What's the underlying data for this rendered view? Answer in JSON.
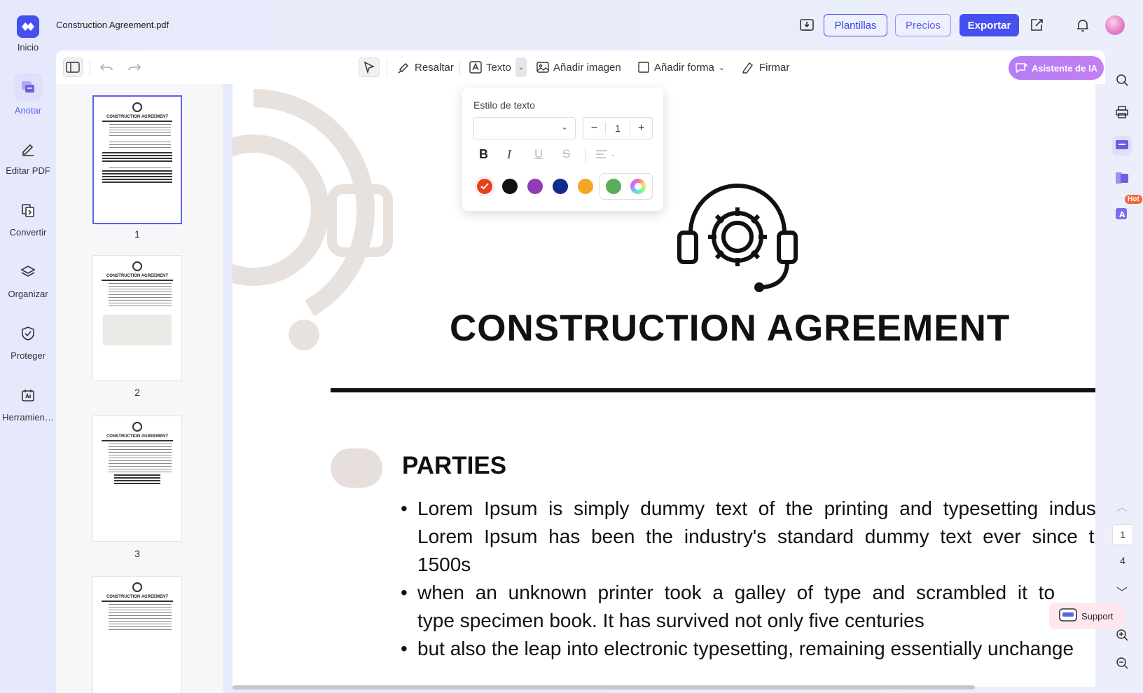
{
  "app": {
    "file_name": "Construction Agreement.pdf",
    "accent": "#4650ee"
  },
  "rail": {
    "items": [
      {
        "label": "Inicio",
        "icon": "home-logo-icon"
      },
      {
        "label": "Anotar",
        "icon": "annotate-icon"
      },
      {
        "label": "Editar PDF",
        "icon": "edit-pdf-icon"
      },
      {
        "label": "Convertir",
        "icon": "convert-icon"
      },
      {
        "label": "Organizar",
        "icon": "layers-icon"
      },
      {
        "label": "Proteger",
        "icon": "shield-icon"
      },
      {
        "label": "Herramien…",
        "icon": "tools-icon"
      }
    ]
  },
  "header": {
    "templates_label": "Plantillas",
    "pricing_label": "Precios",
    "export_label": "Exportar"
  },
  "toolbar": {
    "highlight_label": "Resaltar",
    "text_label": "Texto",
    "add_image_label": "Añadir imagen",
    "add_shape_label": "Añadir forma",
    "sign_label": "Firmar",
    "ai_label": "Asistente de IA"
  },
  "text_style_popup": {
    "title": "Estilo de texto",
    "font_value": "",
    "size_value": "1",
    "colors": [
      "#e8401c",
      "#111111",
      "#8e3db5",
      "#0f2d8a",
      "#f5a623",
      "#5aad5a"
    ],
    "selected_color": "#e8401c"
  },
  "thumbnails": {
    "pages": [
      "1",
      "2",
      "3"
    ],
    "thumb_title": "CONSTRUCTION AGREEMENT"
  },
  "document": {
    "title": "CONSTRUCTION AGREEMENT",
    "section_heading": "PARTIES",
    "bullet_1_line_1": "Lorem Ipsum is simply dummy text of the printing and typesetting indust",
    "bullet_1_line_2": "Lorem Ipsum has been the industry's standard dummy text ever since t",
    "bullet_1_line_3": "1500s",
    "bullet_2_line_1": "when an unknown printer took a galley of type and scrambled it to",
    "bullet_2_line_2": "type specimen book. It has survived not only five centuries",
    "bullet_3_line_1": "but also the leap into electronic typesetting, remaining essentially unchange"
  },
  "right_rail": {
    "hot_badge": "Hot",
    "current_page": "1",
    "total_pages": "4",
    "support_label": "Support"
  }
}
